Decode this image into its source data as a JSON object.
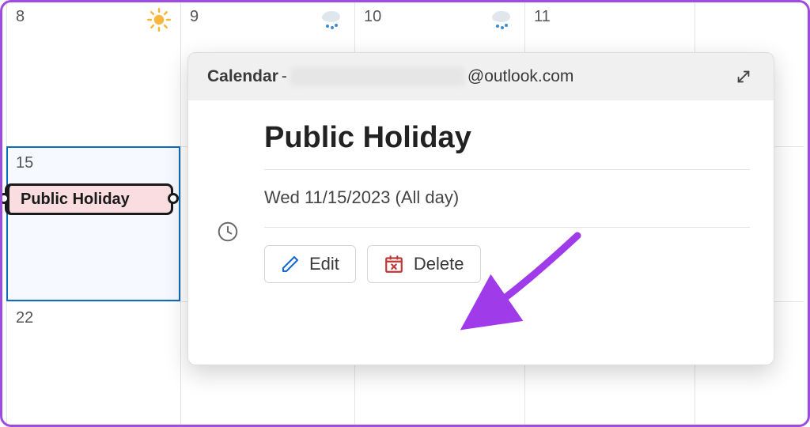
{
  "calendar": {
    "days": {
      "r0c0": "8",
      "r0c1": "9",
      "r0c2": "10",
      "r0c3": "11",
      "r1c0": "15",
      "r2c0": "22"
    },
    "event_label": "Public Holiday"
  },
  "popup": {
    "header": {
      "calendar_label": "Calendar",
      "separator": " - ",
      "email_suffix": "@outlook.com"
    },
    "title": "Public Holiday",
    "datetime": "Wed 11/15/2023 (All day)",
    "buttons": {
      "edit": "Edit",
      "delete": "Delete"
    }
  }
}
